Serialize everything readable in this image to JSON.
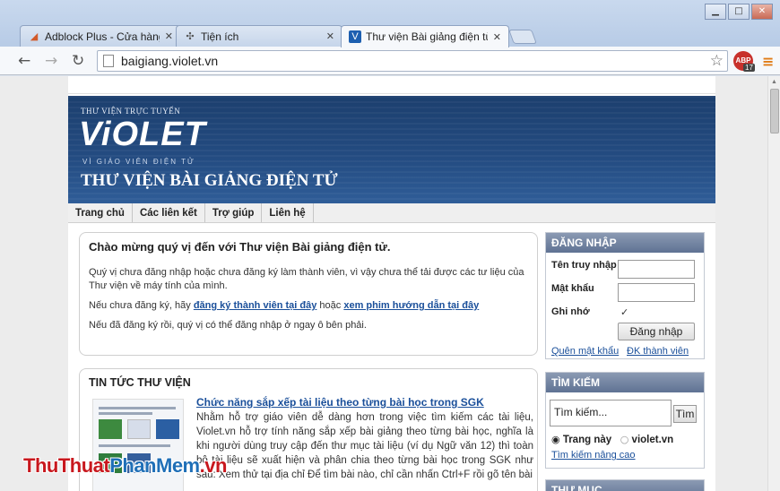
{
  "browser": {
    "tabs": [
      {
        "title": "Adblock Plus - Cửa hàng ",
        "favicon": "chrome-store-icon"
      },
      {
        "title": "Tiện ích",
        "favicon": "puzzle-icon"
      },
      {
        "title": "Thư viện Bài giảng điện tử",
        "favicon": "violet-icon"
      }
    ],
    "url": "baigiang.violet.vn",
    "abp_label": "ABP",
    "abp_count": "17",
    "icons": {
      "back": "back-arrow-icon",
      "forward": "forward-arrow-icon",
      "reload": "reload-icon",
      "star": "bookmark-star-icon",
      "menu": "menu-icon"
    }
  },
  "site": {
    "banner": {
      "tagline_top": "THƯ VIỆN TRỰC TUYẾN",
      "logo": "ViOLET",
      "logo_sub": "VÌ GIÁO VIÊN ĐIỆN TỬ",
      "title": "THƯ VIỆN BÀI GIẢNG ĐIỆN TỬ"
    },
    "nav": [
      "Trang chủ",
      "Các liên kết",
      "Trợ giúp",
      "Liên hệ"
    ],
    "welcome": {
      "heading": "Chào mừng quý vị đến với Thư viện Bài giảng điện tử.",
      "p1": "Quý vị chưa đăng nhập hoặc chưa đăng ký làm thành viên, vì vậy chưa thể tải được các tư liệu của Thư viện về máy tính của mình.",
      "p2_prefix": "Nếu chưa đăng ký, hãy ",
      "p2_link1": "đăng ký thành viên tại đây",
      "p2_middle": " hoặc ",
      "p2_link2": "xem phim hướng dẫn tại đây",
      "p3": "Nếu đã đăng ký rồi, quý vị có thể đăng nhập ở ngay ô bên phải."
    },
    "news": {
      "heading": "TIN TỨC THƯ VIỆN",
      "article_title": "Chức năng sắp xếp tài liệu theo từng bài học trong SGK",
      "article_body": "Nhằm hỗ trợ giáo viên dễ dàng hơn trong việc tìm kiếm các tài liệu, Violet.vn hỗ trợ tính năng sắp xếp bài giảng theo từng bài học, nghĩa là khi người dùng truy cập đến thư mục tài liệu (ví dụ Ngữ văn 12) thì toàn bộ tài liệu sẽ xuất hiện và phân chia theo từng bài học trong SGK như sau: Xem thử tại địa chỉ Để tìm bài nào, chỉ cần nhấn Ctrl+F rồi gõ tên bài"
    },
    "login": {
      "heading": "ĐĂNG NHẬP",
      "username_label": "Tên truy nhập",
      "password_label": "Mật khẩu",
      "remember_label": "Ghi nhớ",
      "remember_checked": "✓",
      "submit": "Đăng nhập",
      "forgot": "Quên mật khẩu",
      "register": "ĐK thành viên"
    },
    "search": {
      "heading": "TÌM KIẾM",
      "placeholder": "Tìm kiếm...",
      "button": "Tìm",
      "option1": "Trang này",
      "option2": "violet.vn",
      "advanced": "Tìm kiếm nâng cao"
    },
    "folder": {
      "heading": "THƯ MỤC"
    }
  },
  "watermark": {
    "part1": "ThuThuat",
    "part2": "PhanMem",
    "part3": ".vn"
  }
}
